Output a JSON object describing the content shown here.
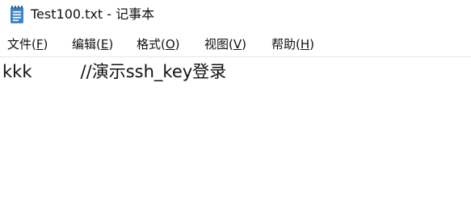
{
  "window": {
    "title": "Test100.txt - 记事本",
    "icon": "notepad-icon"
  },
  "menu": {
    "items": [
      {
        "label": "文件(",
        "key": "F",
        "end": ")"
      },
      {
        "label": "编辑(",
        "key": "E",
        "end": ")"
      },
      {
        "label": "格式(",
        "key": "O",
        "end": ")"
      },
      {
        "label": "视图(",
        "key": "V",
        "end": ")"
      },
      {
        "label": "帮助(",
        "key": "H",
        "end": ")"
      }
    ]
  },
  "editor": {
    "content": "kkk         //演示ssh_key登录"
  },
  "colors": {
    "icon_body": "#3f86c6",
    "icon_lines": "#ffffff",
    "icon_top": "#2b5f8e"
  }
}
